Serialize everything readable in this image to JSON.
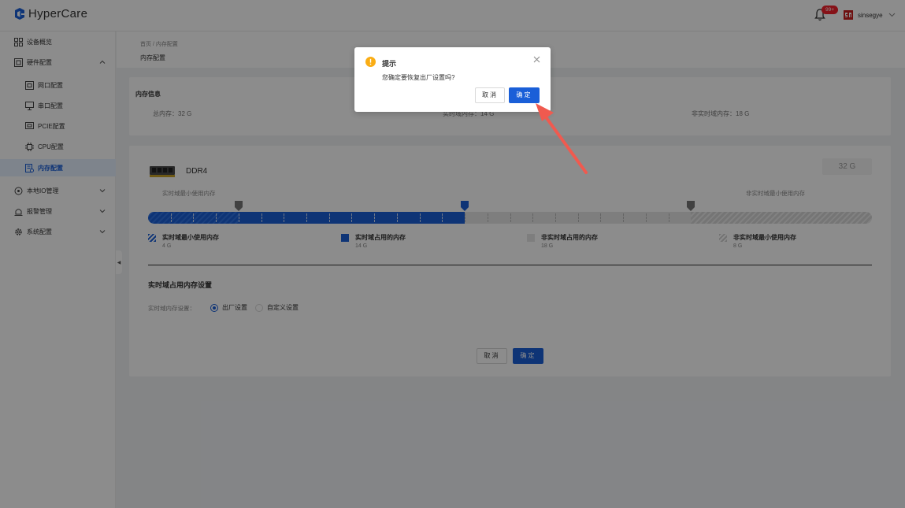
{
  "app": {
    "logo_text": "HyperCare"
  },
  "header": {
    "notification_badge": "99+",
    "username": "sinsegye"
  },
  "sidebar": {
    "items": [
      {
        "label": "设备概览",
        "icon": "grid-icon"
      },
      {
        "label": "硬件配置",
        "icon": "hardware-icon",
        "expanded": true
      },
      {
        "label": "网口配置",
        "icon": "network-port-icon"
      },
      {
        "label": "串口配置",
        "icon": "serial-port-icon"
      },
      {
        "label": "PCIE配置",
        "icon": "pcie-icon"
      },
      {
        "label": "CPU配置",
        "icon": "cpu-icon"
      },
      {
        "label": "内存配置",
        "icon": "memory-icon",
        "active": true
      },
      {
        "label": "本地IO管理",
        "icon": "io-icon"
      },
      {
        "label": "报警管理",
        "icon": "alarm-icon"
      },
      {
        "label": "系统配置",
        "icon": "settings-icon"
      }
    ]
  },
  "breadcrumb": {
    "trail": "首页 / 内存配置",
    "title": "内存配置"
  },
  "memory_info": {
    "title": "内存信息",
    "total": "总内存：32 G",
    "realtime": "实时域内存：14 G",
    "non_realtime": "非实时域内存：18 G"
  },
  "ddr": {
    "name": "DDR4",
    "total": "32 G",
    "label_left": "实时域最小使用内存",
    "label_right": "非实时域最小使用内存",
    "usage_gb": {
      "rt_min": 4,
      "rt_used": 14,
      "nrt_used": 18,
      "nrt_min": 8,
      "total": 32
    },
    "legend": [
      {
        "name": "实时域最小使用内存",
        "value": "4 G",
        "style": "hatch-blue"
      },
      {
        "name": "实时域占用的内存",
        "value": "14 G",
        "style": "blue"
      },
      {
        "name": "非实时域占用的内存",
        "value": "18 G",
        "style": "gray"
      },
      {
        "name": "非实时域最小使用内存",
        "value": "8 G",
        "style": "hatch-gray"
      }
    ]
  },
  "settings": {
    "section_title": "实时域占用内存设置",
    "radio_label": "实时域内存设置：",
    "option_factory": "出厂设置",
    "option_custom": "自定义设置",
    "selected": "出厂设置",
    "cancel": "取消",
    "confirm": "确定"
  },
  "dialog": {
    "title": "提示",
    "message": "您确定要恢复出厂设置吗?",
    "cancel": "取消",
    "confirm": "确定"
  },
  "colors": {
    "primary": "#1a5fd8",
    "badge": "#f5222d",
    "warning": "#faad14",
    "arrow": "#f05a4f"
  }
}
